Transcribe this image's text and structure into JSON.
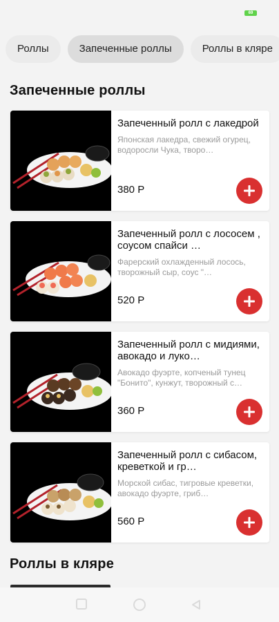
{
  "status_bar": {
    "battery_text": "69"
  },
  "tabs": [
    {
      "label": "Роллы"
    },
    {
      "label": "Запеченные роллы"
    },
    {
      "label": "Роллы в кляре"
    }
  ],
  "sections": [
    {
      "title": "Запеченные роллы",
      "items": [
        {
          "name": "Запеченный ролл с лакедрой",
          "description": "Японская лакедра, свежий огурец, водоросли Чука, творо…",
          "price": "380 Р"
        },
        {
          "name": "Запеченный ролл с лососем , соусом спайси …",
          "description": "Фарерский охлажденный лосось, творожный сыр, соус \"…",
          "price": "520 Р"
        },
        {
          "name": "Запеченный ролл с мидиями, авокадо и луко…",
          "description": "Авокадо фуэрте, копченый тунец \"Бонито\", кунжут, творожный с…",
          "price": "360 Р"
        },
        {
          "name": "Запеченный ролл с сибасом, креветкой и гр…",
          "description": "Морской сибас, тигровые креветки, авокадо фуэрте, гриб…",
          "price": "560 Р"
        }
      ]
    },
    {
      "title": "Роллы в кляре"
    }
  ],
  "colors": {
    "accent": "#d93030",
    "background": "#f3f3f3",
    "card": "#ffffff",
    "muted_text": "#9a9a9a",
    "battery": "#5fd24a"
  },
  "icons": {
    "add": "plus-icon",
    "nav_recents": "square-icon",
    "nav_home": "circle-icon",
    "nav_back": "triangle-back-icon"
  }
}
